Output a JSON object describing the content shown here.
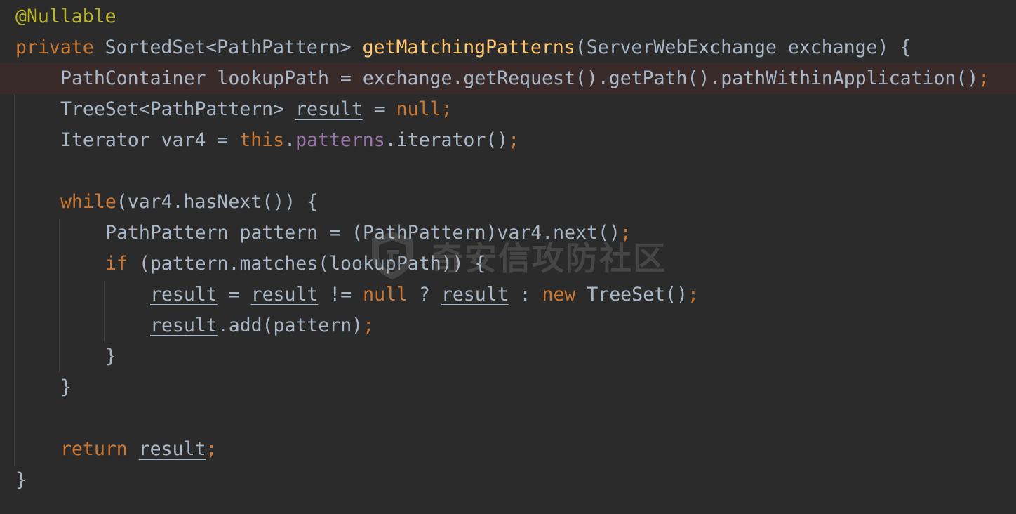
{
  "code": {
    "annotation": "@Nullable",
    "kw_private": "private",
    "return_type": " SortedSet<PathPattern> ",
    "method_name": "getMatchingPatterns",
    "params": "(ServerWebExchange exchange) {",
    "l3_decl": "PathContainer lookupPath = exchange.getRequest().getPath().pathWithinApplication()",
    "semicolon": ";",
    "l4_type": "TreeSet<PathPattern> ",
    "var_result": "result",
    "l4_assign": " = ",
    "kw_null": "null",
    "l5_type": "Iterator var4 = ",
    "kw_this": "this",
    "dot": ".",
    "field_patterns": "patterns",
    "l5_rest": ".iterator()",
    "kw_while": "while",
    "l7_rest": "(var4.hasNext()) {",
    "l8_decl": "PathPattern pattern = (PathPattern)var4.next()",
    "kw_if": "if",
    "l9_rest": " (pattern.matches(lookupPath)) {",
    "l10_neq": " != ",
    "l10_q": " ? ",
    "l10_colon": " : ",
    "kw_new": "new",
    "l10_tail": " TreeSet()",
    "l11_rest": ".add(pattern)",
    "close_brace": "}",
    "kw_return": "return",
    "space": " "
  },
  "watermark": {
    "text": "奇安信攻防社区",
    "logo_icon": "shield-logo-icon"
  }
}
